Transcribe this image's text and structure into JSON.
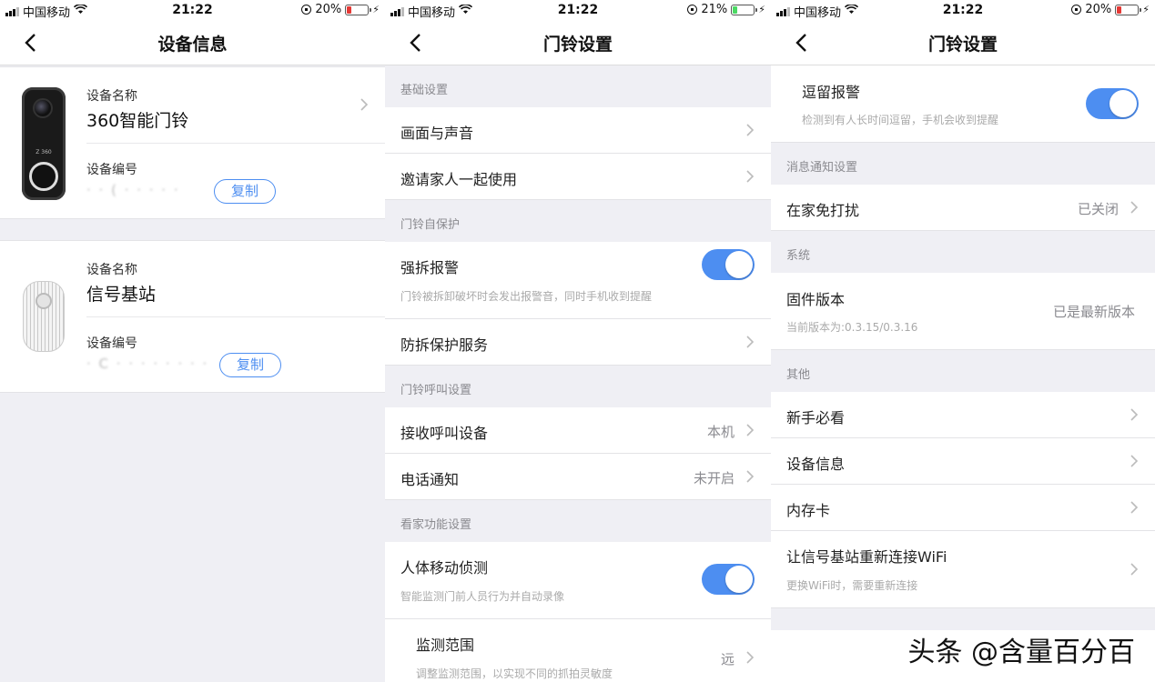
{
  "status": {
    "carrier": "中国移动",
    "time": "21:22",
    "battery": [
      "20%",
      "21%",
      "20%"
    ],
    "battery_colors": [
      "#e53935",
      "#4cd964",
      "#e53935"
    ]
  },
  "panel1": {
    "title": "设备信息",
    "device1": {
      "name_label": "设备名称",
      "name": "360智能门铃",
      "serial_label": "设备编号",
      "serial": "· · ( · · · · ·",
      "copy": "复制"
    },
    "device2": {
      "name_label": "设备名称",
      "name": "信号基站",
      "serial_label": "设备编号",
      "serial": "· C · · · · · · · ·",
      "copy": "复制"
    }
  },
  "panel2": {
    "title": "门铃设置",
    "sec_basic": "基础设置",
    "row_picture_sound": "画面与声音",
    "row_invite_family": "邀请家人一起使用",
    "sec_protect": "门铃自保护",
    "row_tamper_alarm": "强拆报警",
    "row_tamper_alarm_sub": "门铃被拆卸破坏时会发出报警音，同时手机收到提醒",
    "row_tamper_service": "防拆保护服务",
    "sec_call": "门铃呼叫设置",
    "row_receive_device": "接收呼叫设备",
    "row_receive_device_value": "本机",
    "row_phone_notify": "电话通知",
    "row_phone_notify_value": "未开启",
    "sec_home": "看家功能设置",
    "row_motion": "人体移动侦测",
    "row_motion_sub": "智能监测门前人员行为并自动录像",
    "row_range": "监测范围",
    "row_range_sub": "调整监测范围，以实现不同的抓拍灵敏度",
    "row_range_value": "远"
  },
  "panel3": {
    "title": "门铃设置",
    "row_linger": "逗留报警",
    "row_linger_sub": "检测到有人长时间逗留，手机会收到提醒",
    "sec_notify": "消息通知设置",
    "row_dnd": "在家免打扰",
    "row_dnd_value": "已关闭",
    "sec_system": "系统",
    "row_firmware": "固件版本",
    "row_firmware_sub": "当前版本为:0.3.15/0.3.16",
    "row_firmware_value": "已是最新版本",
    "sec_other": "其他",
    "row_guide": "新手必看",
    "row_device_info": "设备信息",
    "row_memory_card": "内存卡",
    "row_reconnect_wifi": "让信号基站重新连接WiFi",
    "row_reconnect_wifi_sub": "更换WiFi时，需要重新连接"
  },
  "watermark": "头条 @含量百分百",
  "colors": {
    "accent": "#4d8ef1",
    "background": "#efeff4"
  }
}
